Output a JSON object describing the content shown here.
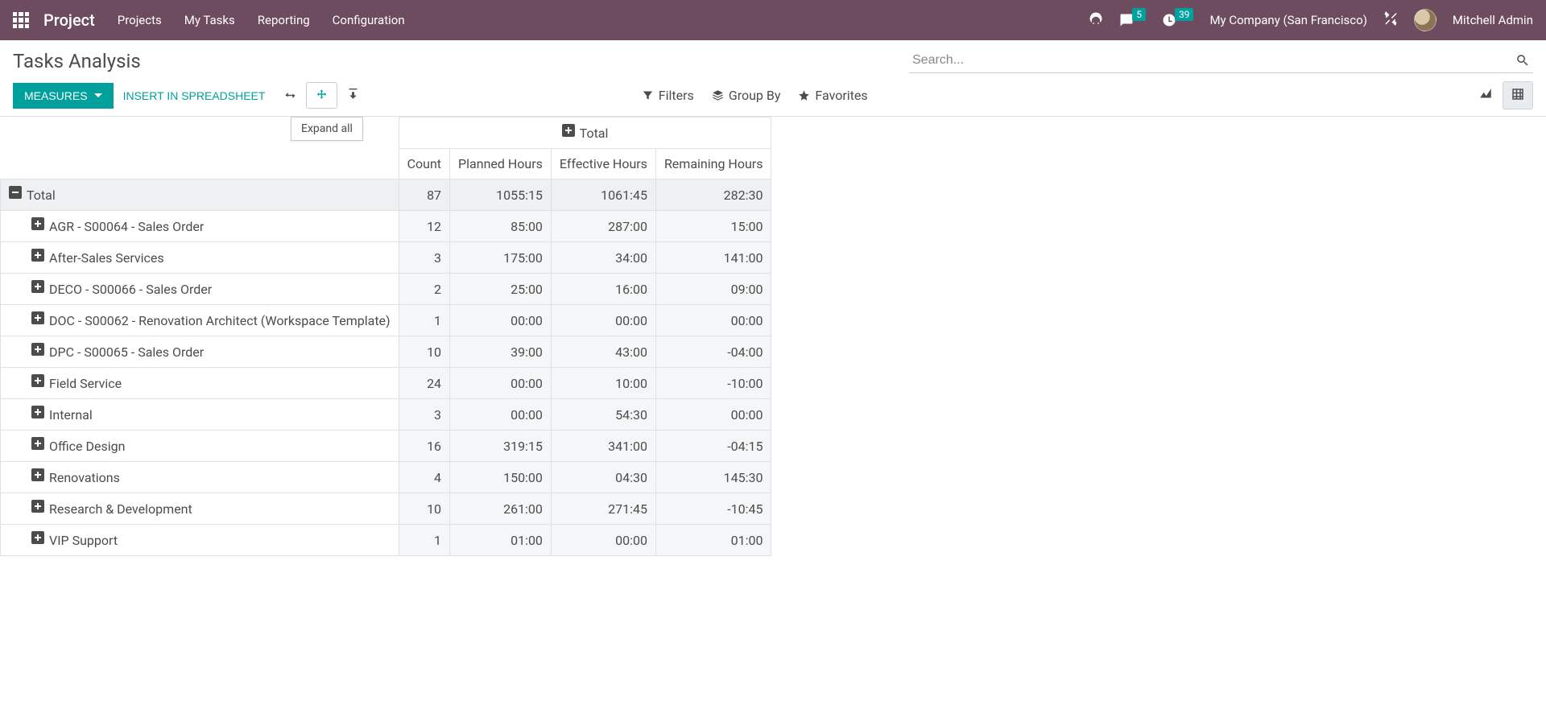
{
  "nav": {
    "brand": "Project",
    "menu": [
      "Projects",
      "My Tasks",
      "Reporting",
      "Configuration"
    ],
    "company": "My Company (San Francisco)",
    "user": "Mitchell Admin",
    "msg_badge": "5",
    "act_badge": "39"
  },
  "cp": {
    "title": "Tasks Analysis",
    "search_placeholder": "Search...",
    "measures": "Measures",
    "insert": "Insert in Spreadsheet",
    "tooltip": "Expand all",
    "filters": "Filters",
    "groupby": "Group By",
    "favorites": "Favorites"
  },
  "pivot": {
    "col_total": "Total",
    "row_total": "Total",
    "measures": [
      "Count",
      "Planned Hours",
      "Effective Hours",
      "Remaining Hours"
    ],
    "total_row": {
      "count": "87",
      "planned": "1055:15",
      "effective": "1061:45",
      "remaining": "282:30"
    },
    "rows": [
      {
        "label": "AGR - S00064 - Sales Order",
        "count": "12",
        "planned": "85:00",
        "effective": "287:00",
        "remaining": "15:00"
      },
      {
        "label": "After-Sales Services",
        "count": "3",
        "planned": "175:00",
        "effective": "34:00",
        "remaining": "141:00"
      },
      {
        "label": "DECO - S00066 - Sales Order",
        "count": "2",
        "planned": "25:00",
        "effective": "16:00",
        "remaining": "09:00"
      },
      {
        "label": "DOC - S00062 - Renovation Architect (Workspace Template)",
        "count": "1",
        "planned": "00:00",
        "effective": "00:00",
        "remaining": "00:00"
      },
      {
        "label": "DPC - S00065 - Sales Order",
        "count": "10",
        "planned": "39:00",
        "effective": "43:00",
        "remaining": "-04:00"
      },
      {
        "label": "Field Service",
        "count": "24",
        "planned": "00:00",
        "effective": "10:00",
        "remaining": "-10:00"
      },
      {
        "label": "Internal",
        "count": "3",
        "planned": "00:00",
        "effective": "54:30",
        "remaining": "00:00"
      },
      {
        "label": "Office Design",
        "count": "16",
        "planned": "319:15",
        "effective": "341:00",
        "remaining": "-04:15"
      },
      {
        "label": "Renovations",
        "count": "4",
        "planned": "150:00",
        "effective": "04:30",
        "remaining": "145:30"
      },
      {
        "label": "Research & Development",
        "count": "10",
        "planned": "261:00",
        "effective": "271:45",
        "remaining": "-10:45"
      },
      {
        "label": "VIP Support",
        "count": "1",
        "planned": "01:00",
        "effective": "00:00",
        "remaining": "01:00"
      }
    ]
  }
}
